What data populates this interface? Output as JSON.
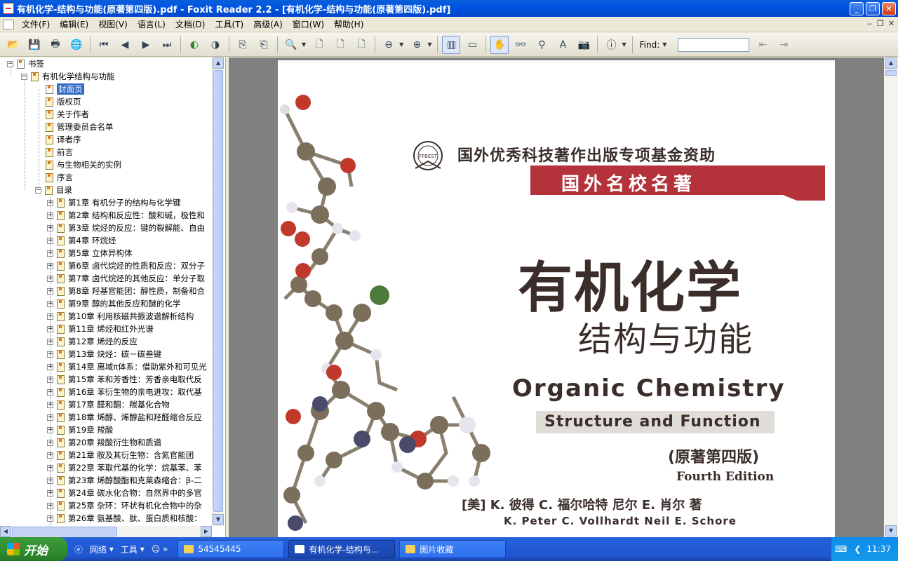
{
  "window": {
    "title": "有机化学-结构与功能(原著第四版).pdf - Foxit Reader 2.2 - [有机化学-结构与功能(原著第四版).pdf]",
    "minimize": "_",
    "restore": "❐",
    "close": "✕"
  },
  "menu": [
    "文件(F)",
    "编辑(E)",
    "视图(V)",
    "语言(L)",
    "文档(D)",
    "工具(T)",
    "高级(A)",
    "窗口(W)",
    "帮助(H)"
  ],
  "toolbar": {
    "find_label": "Find:",
    "find_value": ""
  },
  "bookmarks": {
    "root": "书签",
    "book": "有机化学结构与功能",
    "front": [
      "封面页",
      "版权页",
      "关于作者",
      "管理委员会名单",
      "译者序",
      "前言",
      "与生物相关的实例",
      "序言"
    ],
    "toc_label": "目录",
    "chapters": [
      "第1章 有机分子的结构与化学键",
      "第2章 结构和反应性：酸和碱，极性和",
      "第3章 烷烃的反应：键的裂解能、自由",
      "第4章 环烷烃",
      "第5章 立体异构体",
      "第6章 卤代烷烃的性质和反应：双分子",
      "第7章 卤代烷烃的其他反应：单分子取",
      "第8章 羟基官能团：醇性质，制备和合",
      "第9章 醇的其他反应和醚的化学",
      "第10章 利用核磁共振波谱解析结构",
      "第11章 烯烃和红外光谱",
      "第12章 烯烃的反应",
      "第13章 炔烃：碳－碳叁键",
      "第14章 离域π体系：借助紫外和可见光",
      "第15章 苯和芳香性：芳香亲电取代反",
      "第16章 苯衍生物的亲电进攻：取代基",
      "第17章 醛和酮：羰基化合物",
      "第18章 烯醇、烯醇盐和羟醛缩合反应",
      "第19章 羧酸",
      "第20章 羧酸衍生物和质谱",
      "第21章 胺及其衍生物：含氮官能团",
      "第22章 苯取代基的化学：烷基苯、苯",
      "第23章 烯醇酸酯和克莱森缩合：β-二",
      "第24章 碳水化合物：自然界中的多官",
      "第25章 杂环：环状有机化合物中的杂",
      "第26章 氨基酸、肽、蛋白质和核酸："
    ]
  },
  "cover": {
    "fund": "国外优秀科技著作出版专项基金资助",
    "logo_text": "FFBEST",
    "ribbon": "国外名校名著",
    "title_cn": "有机化学",
    "subtitle_cn": "结构与功能",
    "title_en": "Organic Chemistry",
    "subtitle_en": "Structure and Function",
    "edition_cn": "(原著第四版)",
    "edition_en": "Fourth Edition",
    "authors_cn": "[美] K. 彼得 C. 福尔哈特    尼尔 E. 肖尔  著",
    "authors_en": "K. Peter C. Vollhardt       Neil E. Schore"
  },
  "taskbar": {
    "start": "开始",
    "quick1": "网络",
    "quick2": "工具",
    "tasks": [
      "54545445",
      "有机化学-结构与...",
      "图片收藏"
    ],
    "clock": "11:37"
  }
}
